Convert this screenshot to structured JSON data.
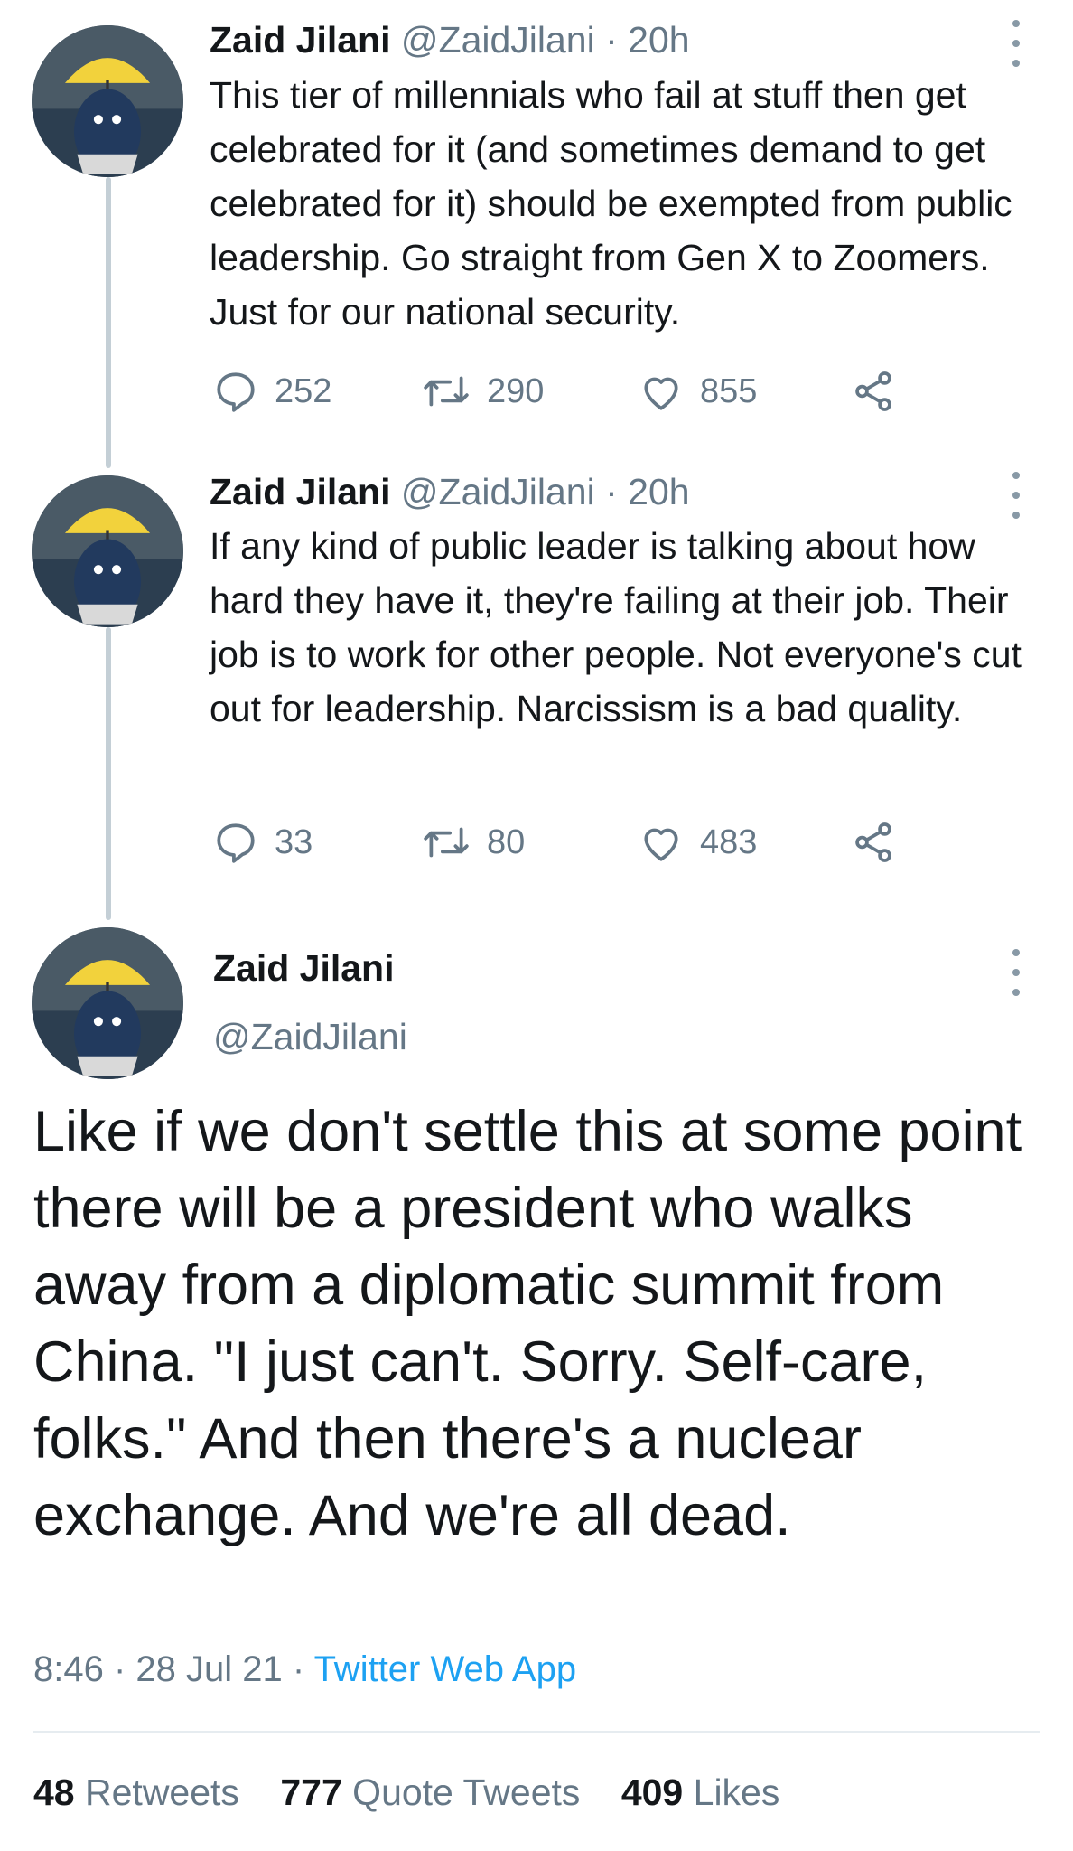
{
  "tweets": [
    {
      "name": "Zaid Jilani",
      "handle": "@ZaidJilani",
      "time": " · 20h",
      "text": "This tier of millennials who fail at stuff then get celebrated for it (and sometimes demand to get celebrated for it) should be exempted from public leadership. Go straight from Gen X to Zoomers. Just for our national security.",
      "replies": "252",
      "retweets": "290",
      "likes": "855"
    },
    {
      "name": "Zaid Jilani",
      "handle": "@ZaidJilani",
      "time": " · 20h",
      "text": "If any kind of public leader is talking about how hard they have it, they're failing at their job. Their job is to work for other people. Not everyone's cut out for leadership. Narcissism is a bad quality.",
      "replies": "33",
      "retweets": "80",
      "likes": "483"
    }
  ],
  "main_tweet": {
    "name": "Zaid Jilani",
    "handle": "@ZaidJilani",
    "text": "Like if we don't settle this at some point there will be a president who walks away from a diplomatic summit from China. \"I just can't. Sorry. Self-care, folks.\" And then there's a nuclear exchange. And we're all dead.",
    "timestamp": "8:46 · 28 Jul 21 · ",
    "source": "Twitter Web App",
    "stats": {
      "retweets_count": "48",
      "retweets_label": "Retweets",
      "quotes_count": "777",
      "quotes_label": "Quote Tweets",
      "likes_count": "409",
      "likes_label": "Likes"
    }
  },
  "colors": {
    "text": "#14171a",
    "secondary": "#657786",
    "link": "#1da1f2",
    "thread_line": "#c4cfd6"
  },
  "icons": [
    "reply-icon",
    "retweet-icon",
    "like-icon",
    "share-icon",
    "more-icon"
  ]
}
